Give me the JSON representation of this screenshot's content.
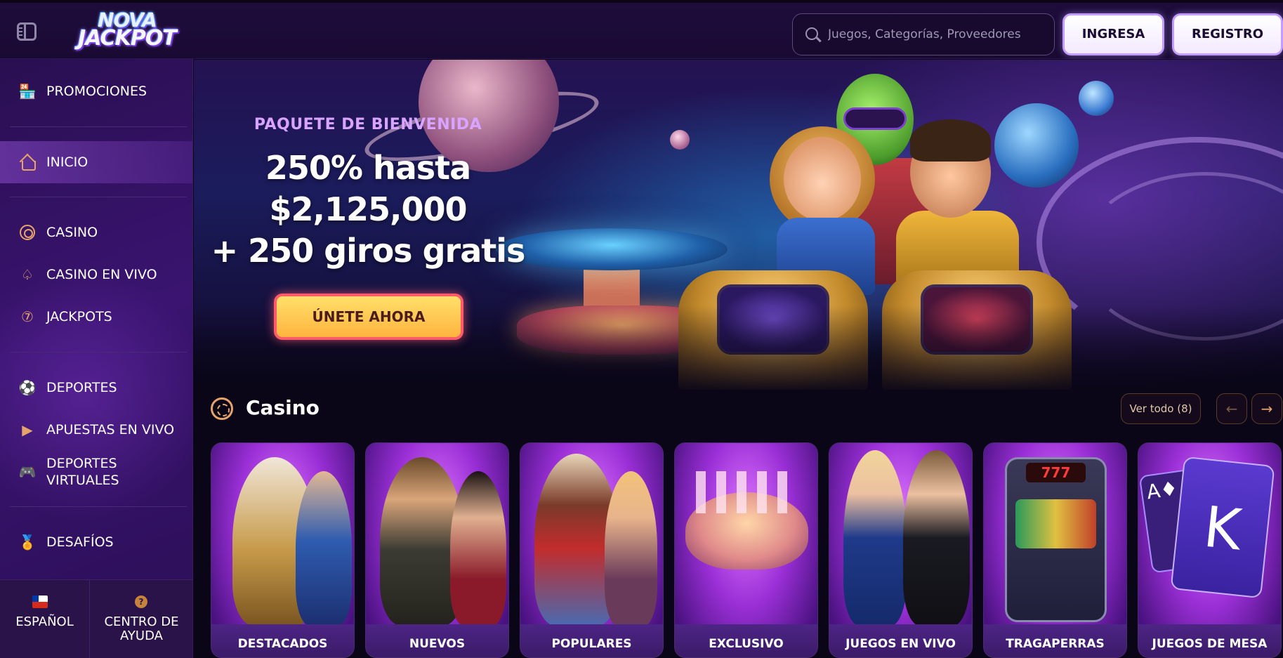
{
  "header": {
    "logo_line1": "NOVA",
    "logo_line2": "JACKPOT",
    "search_placeholder": "Juegos, Categorías, Proveedores",
    "login_label": "INGRESA",
    "register_label": "REGISTRO"
  },
  "sidebar": {
    "items": [
      {
        "label": "PROMOCIONES",
        "icon": "gift-store-icon"
      },
      {
        "label": "INICIO",
        "icon": "home-icon",
        "active": true
      },
      {
        "label": "CASINO",
        "icon": "casino-chip-icon"
      },
      {
        "label": "CASINO EN VIVO",
        "icon": "spade-icon"
      },
      {
        "label": "JACKPOTS",
        "icon": "seven-icon"
      },
      {
        "label": "DEPORTES",
        "icon": "soccer-ball-icon"
      },
      {
        "label": "APUESTAS EN VIVO",
        "icon": "play-icon"
      },
      {
        "label": "DEPORTES VIRTUALES",
        "icon": "gamepad-icon"
      },
      {
        "label": "DESAFÍOS",
        "icon": "medal-icon"
      }
    ],
    "footer": {
      "language_label": "ESPAÑOL",
      "help_label": "CENTRO DE AYUDA"
    }
  },
  "hero": {
    "subtitle": "PAQUETE DE BIENVENIDA",
    "title_line1": "250% hasta",
    "title_line2": "$2,125,000",
    "title_line3": "+ 250 giros gratis",
    "cta_label": "ÚNETE AHORA"
  },
  "casino": {
    "title": "Casino",
    "view_all_label": "Ver todo (8)",
    "cards": [
      {
        "label": "DESTACADOS"
      },
      {
        "label": "NUEVOS"
      },
      {
        "label": "POPULARES"
      },
      {
        "label": "EXCLUSIVO"
      },
      {
        "label": "JUEGOS EN VIVO"
      },
      {
        "label": "TRAGAPERRAS"
      },
      {
        "label": "JUEGOS DE MESA"
      }
    ]
  },
  "colors": {
    "accent_orange": "#e7a46a",
    "accent_purple": "#c49bff",
    "cta_yellow": "#ffd05a",
    "background": "#0a0618"
  }
}
